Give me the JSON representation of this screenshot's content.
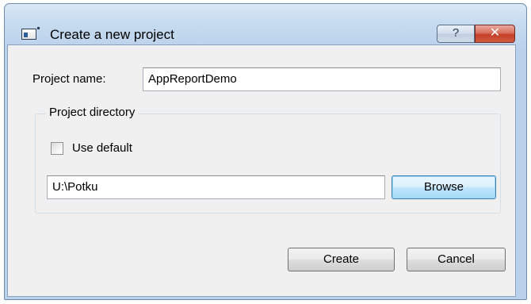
{
  "window": {
    "title": "Create a new project",
    "help_label": "?",
    "close_label": "✕"
  },
  "form": {
    "project_name_label": "Project name:",
    "project_name_value": "AppReportDemo",
    "group_title": "Project directory",
    "use_default_label": "Use default",
    "use_default_checked": false,
    "directory_value": "U:\\Potku",
    "browse_label": "Browse"
  },
  "actions": {
    "create_label": "Create",
    "cancel_label": "Cancel"
  },
  "colors": {
    "title_bar": "#b9d1ea",
    "close_button": "#c4412a",
    "client_background": "#f0f0f0",
    "focused_button_border": "#3c7fb1"
  },
  "icons": {
    "window_icon": "application-window-icon",
    "help": "help-icon",
    "close": "close-icon"
  }
}
